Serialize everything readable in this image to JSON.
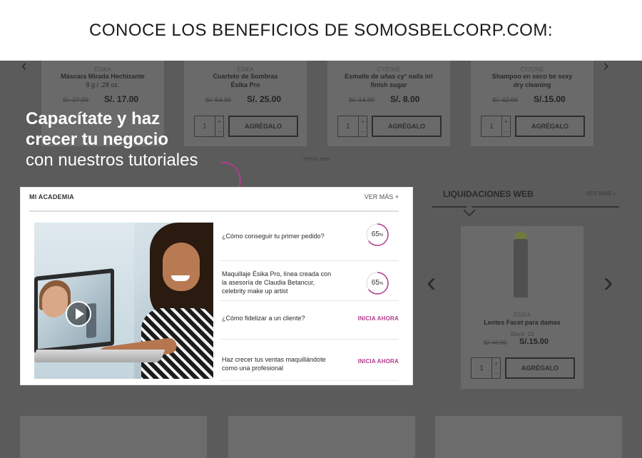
{
  "banner": {
    "title": "CONOCE LOS BENEFICIOS DE SOMOSBELCORP.COM:"
  },
  "promo": {
    "line1": "Capacítate y haz",
    "line2": "crecer tu negocio",
    "line3": "con nuestros tutoriales"
  },
  "background": {
    "products": [
      {
        "brand": "ÉSIKA",
        "name": "Máscara Mirada Hechizante",
        "name2": "8 g / .28 oz.",
        "old_price": "S/. 27.00",
        "price": "S/. 17.00",
        "qty": "1",
        "button": "AGRÉGALO"
      },
      {
        "brand": "ÉSIKA",
        "name": "Cuarteto de Sombras",
        "name2": "Ésika Pro",
        "old_price": "S/. 54.00",
        "price": "S/. 25.00",
        "qty": "1",
        "button": "AGRÉGALO"
      },
      {
        "brand": "CYZONE",
        "name": "Esmalte de uñas cy° nails in!",
        "name2": "finish sugar",
        "old_price": "S/. 14.90",
        "price": "S/. 8.00",
        "qty": "1",
        "button": "AGRÉGALO"
      },
      {
        "brand": "CYZONE",
        "name": "Shampoo en seco be sexy",
        "name2": "dry cleaning",
        "old_price": "S/. 42.00",
        "price": "S/.15.00",
        "qty": "1",
        "button": "AGRÉGALO"
      }
    ],
    "price_note": "* Precio neto.",
    "liquidaciones": {
      "title": "LIQUIDACIONES WEB",
      "more": "VER MÁS +",
      "brand": "ÉSIKA",
      "name": "Lentes Facet para damas",
      "stock": "Stock: 20",
      "old_price": "S/. 42.00",
      "price": "S/.15.00",
      "qty": "1",
      "button": "AGRÉGALO"
    }
  },
  "academy": {
    "title": "MI ACADEMIA",
    "more": "VER MÁS +",
    "lessons": [
      {
        "text": "¿Cómo conseguir tu primer pedido?",
        "progress": 65,
        "progress_label": "65",
        "unit": "%"
      },
      {
        "text": "Maquillaje Ésika Pro, línea creada con la asesoría de Claudia Betancur, celebrity make up artist",
        "progress": 65,
        "progress_label": "65",
        "unit": "%"
      },
      {
        "text": "¿Cómo fidelizar a un cliente?",
        "cta": "INICIA AHORA"
      },
      {
        "text": "Haz crecer tus ventas maquillándote como una profesional",
        "cta": "INICIA AHORA"
      }
    ]
  },
  "colors": {
    "accent": "#b23c8c",
    "overlay": "#5b5b5b"
  }
}
